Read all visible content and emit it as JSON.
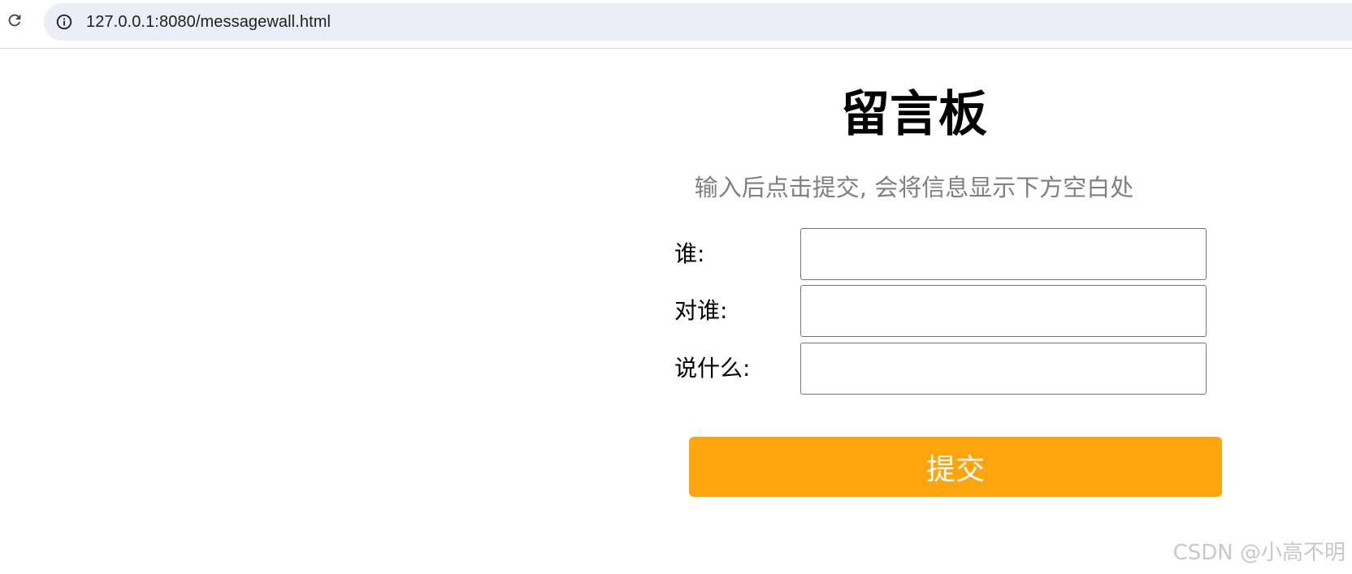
{
  "browser": {
    "url": "127.0.0.1:8080/messagewall.html",
    "reload_icon": "reload-icon",
    "info_icon": "info-icon"
  },
  "page": {
    "title": "留言板",
    "subtitle": "输入后点击提交, 会将信息显示下方空白处",
    "form": {
      "fields": [
        {
          "label": "谁:",
          "value": ""
        },
        {
          "label": "对谁:",
          "value": ""
        },
        {
          "label": "说什么:",
          "value": ""
        }
      ],
      "submit_label": "提交"
    },
    "watermark": "CSDN @小高不明"
  },
  "colors": {
    "submit_button_bg": "#fea40c",
    "subtitle_color": "#808080",
    "omnibox_bg": "#ebeef6"
  }
}
